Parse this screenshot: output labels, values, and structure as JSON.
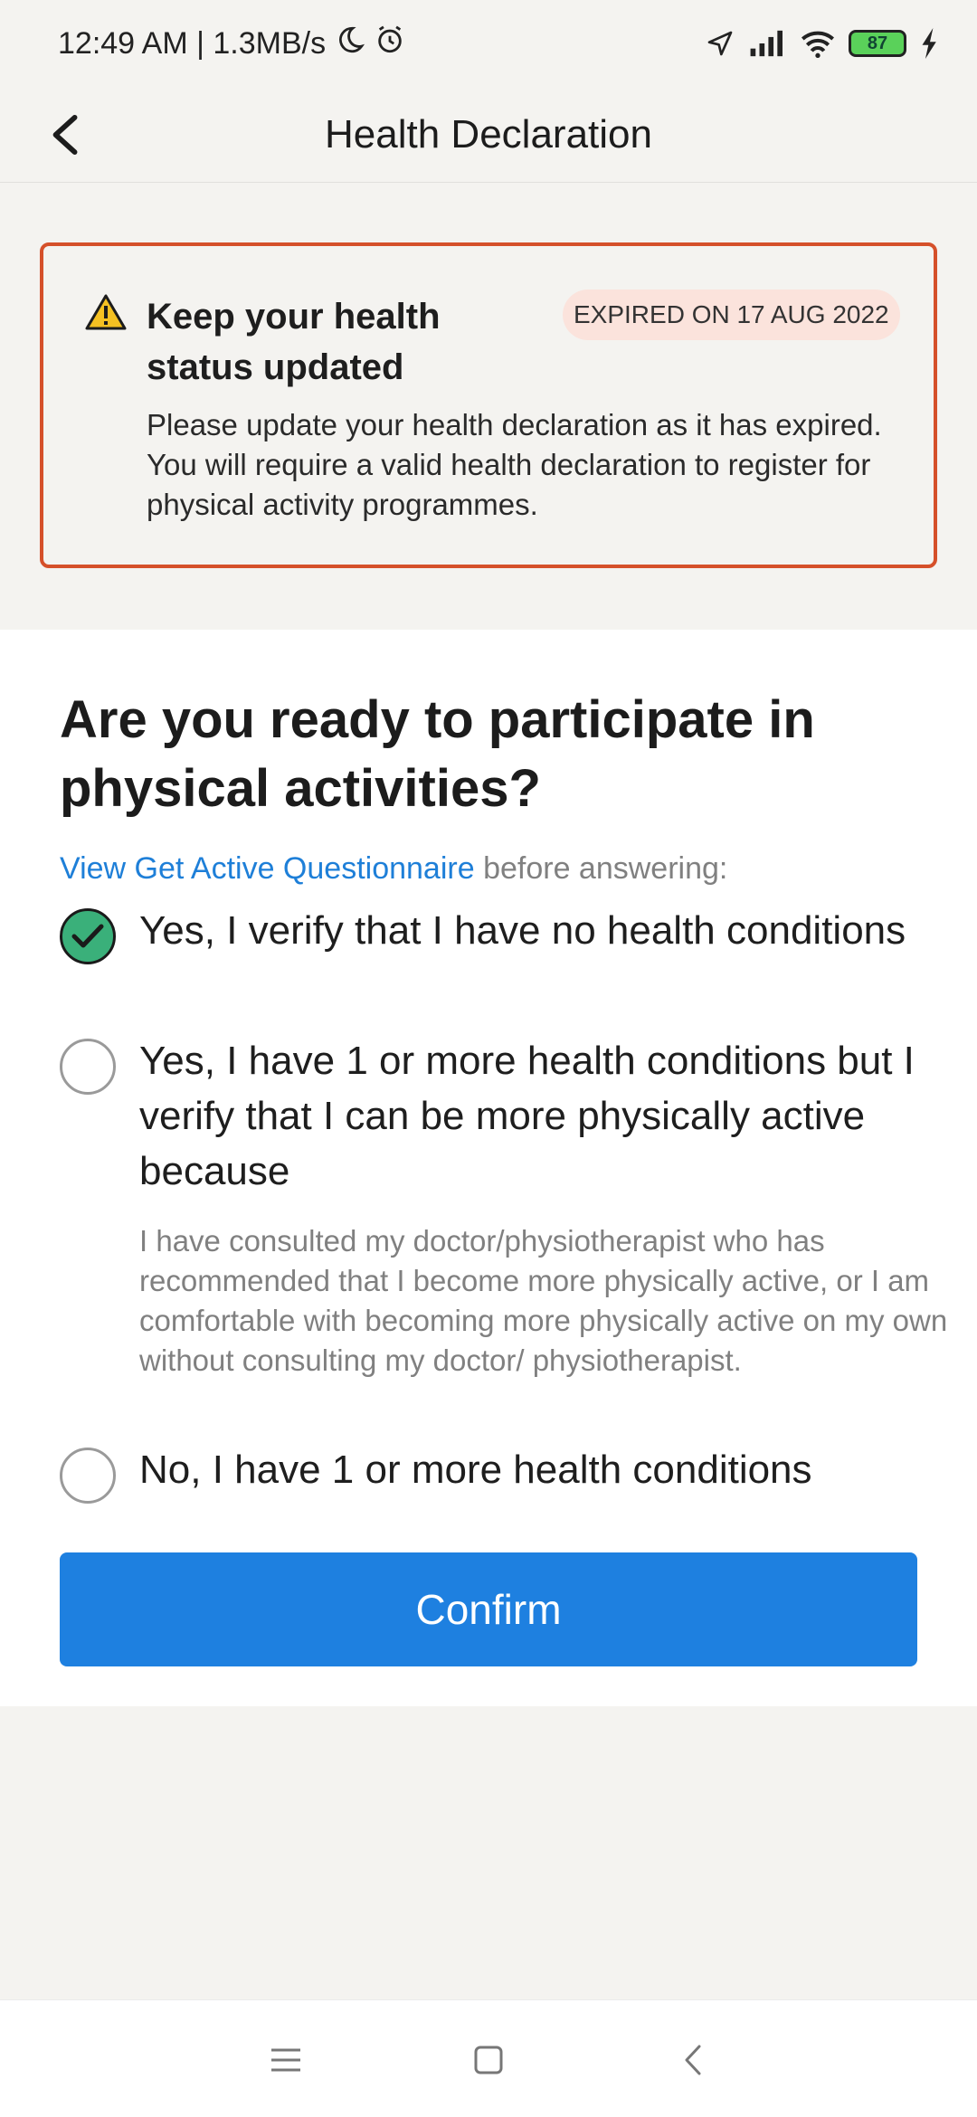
{
  "status_bar": {
    "time_speed": "12:49 AM | 1.3MB/s",
    "battery_level": "87"
  },
  "header": {
    "title": "Health Declaration"
  },
  "alert": {
    "title": "Keep your health status updated",
    "badge": "EXPIRED ON 17 AUG 2022",
    "body": "Please update your health declaration as it has expired. You will require a valid health declaration to register for physical activity programmes.",
    "border_color": "#d5502a"
  },
  "form": {
    "question": "Are you ready to participate in physical activities?",
    "hint_link": "View Get Active Questionnaire",
    "hint_text": " before answering:",
    "options": [
      {
        "label": "Yes, I verify that I have no health conditions",
        "selected": true
      },
      {
        "label": "Yes, I have 1 or more health conditions but I verify that I can be more physically active because",
        "detail": "I have consulted my doctor/physiotherapist who has recommended that I become more physically active, or I am comfortable with becoming more physically active on my own without consulting my doctor/ physiotherapist.",
        "selected": false
      },
      {
        "label": "No, I have 1 or more health conditions",
        "selected": false
      }
    ],
    "confirm_label": "Confirm",
    "accent_color": "#1e80e0",
    "selected_color": "#3ab07a"
  }
}
